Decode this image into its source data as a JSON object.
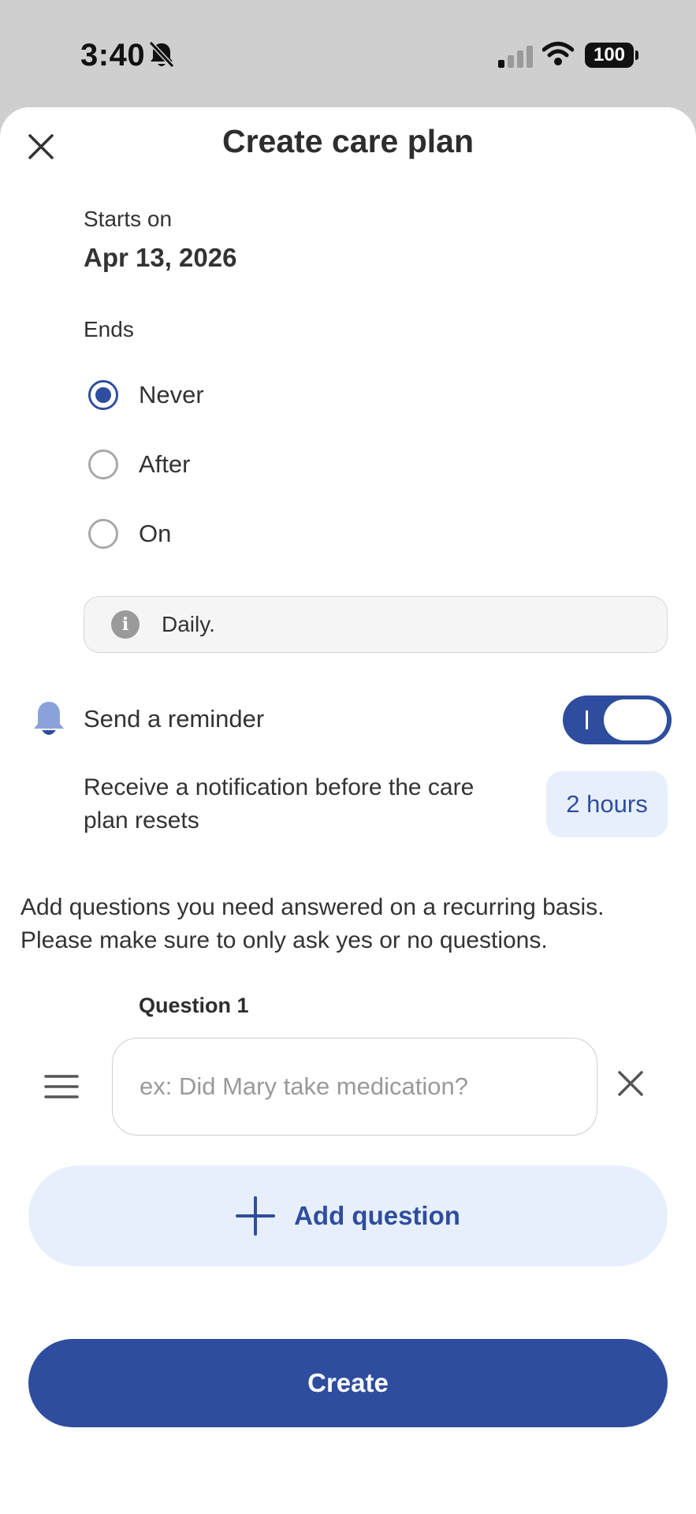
{
  "status_bar": {
    "time": "3:40",
    "battery": "100",
    "icons": [
      "bell-slash-icon",
      "cellular-signal-icon",
      "wifi-icon",
      "battery-icon"
    ]
  },
  "header": {
    "title": "Create care plan",
    "close_icon": "close-icon"
  },
  "starts": {
    "label": "Starts on",
    "date": "Apr 13, 2026"
  },
  "ends": {
    "label": "Ends",
    "options": [
      {
        "label": "Never",
        "selected": true
      },
      {
        "label": "After",
        "selected": false
      },
      {
        "label": "On",
        "selected": false
      }
    ]
  },
  "frequency_info": {
    "icon": "info-icon",
    "icon_glyph": "i",
    "text": "Daily."
  },
  "reminder": {
    "icon": "bell-icon",
    "label": "Send a reminder",
    "enabled": true,
    "description": "Receive a notification before the care plan resets",
    "lead_time": "2 hours"
  },
  "questions": {
    "instructions": "Add questions you need answered on a recurring basis. Please make sure to only ask yes or no questions.",
    "items": [
      {
        "label": "Question 1",
        "value": "",
        "placeholder": "ex: Did Mary take medication?"
      }
    ],
    "add_label": "Add question"
  },
  "actions": {
    "create_label": "Create"
  },
  "colors": {
    "accent": "#2e4d9f",
    "accent_light": "#e8effc",
    "bell": "#8aa1db"
  }
}
